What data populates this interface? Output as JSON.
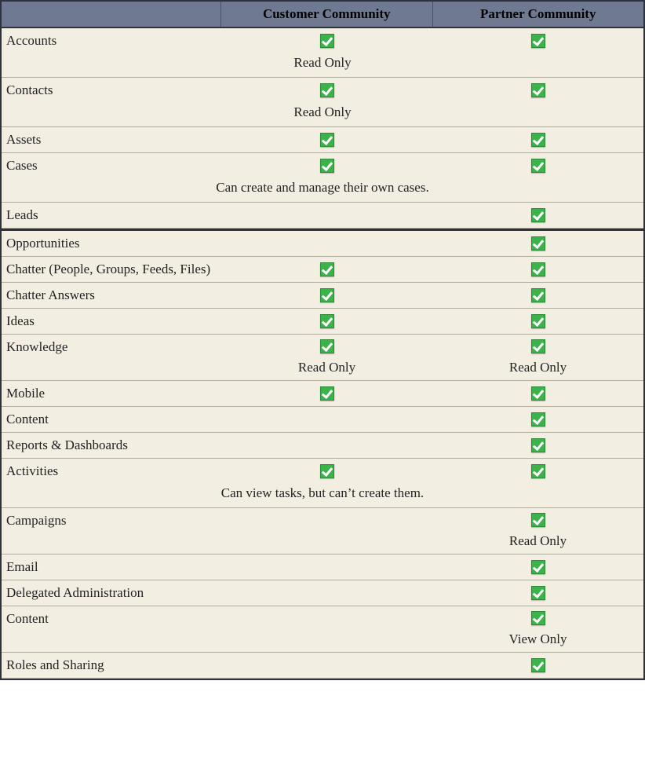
{
  "headers": {
    "feature": "",
    "customer": "Customer Community",
    "partner": "Partner Community"
  },
  "rows": [
    {
      "feature": "Accounts",
      "customer_check": true,
      "partner_check": true,
      "span_note": "Read Only",
      "customer_note": "",
      "partner_note": ""
    },
    {
      "feature": "Contacts",
      "customer_check": true,
      "partner_check": true,
      "span_note": "Read Only",
      "customer_note": "",
      "partner_note": ""
    },
    {
      "feature": "Assets",
      "customer_check": true,
      "partner_check": true,
      "span_note": "",
      "customer_note": "",
      "partner_note": ""
    },
    {
      "feature": "Cases",
      "customer_check": true,
      "partner_check": true,
      "span_note": "Can create and manage their own cases.",
      "customer_note": "",
      "partner_note": ""
    },
    {
      "feature": "Leads",
      "customer_check": false,
      "partner_check": true,
      "span_note": "",
      "customer_note": "",
      "partner_note": "",
      "break_after": true
    },
    {
      "feature": "Opportunities",
      "customer_check": false,
      "partner_check": true,
      "span_note": "",
      "customer_note": "",
      "partner_note": ""
    },
    {
      "feature": "Chatter (People, Groups, Feeds, Files)",
      "customer_check": true,
      "partner_check": true,
      "span_note": "",
      "customer_note": "",
      "partner_note": ""
    },
    {
      "feature": "Chatter Answers",
      "customer_check": true,
      "partner_check": true,
      "span_note": "",
      "customer_note": "",
      "partner_note": ""
    },
    {
      "feature": "Ideas",
      "customer_check": true,
      "partner_check": true,
      "span_note": "",
      "customer_note": "",
      "partner_note": ""
    },
    {
      "feature": "Knowledge",
      "customer_check": true,
      "partner_check": true,
      "span_note": "",
      "customer_note": "Read Only",
      "partner_note": "Read Only"
    },
    {
      "feature": "Mobile",
      "customer_check": true,
      "partner_check": true,
      "span_note": "",
      "customer_note": "",
      "partner_note": ""
    },
    {
      "feature": "Content",
      "customer_check": false,
      "partner_check": true,
      "span_note": "",
      "customer_note": "",
      "partner_note": ""
    },
    {
      "feature": "Reports & Dashboards",
      "customer_check": false,
      "partner_check": true,
      "span_note": "",
      "customer_note": "",
      "partner_note": ""
    },
    {
      "feature": "Activities",
      "customer_check": true,
      "partner_check": true,
      "span_note": "Can view tasks, but can’t create them.",
      "customer_note": "",
      "partner_note": ""
    },
    {
      "feature": "Campaigns",
      "customer_check": false,
      "partner_check": true,
      "span_note": "",
      "customer_note": "",
      "partner_note": "Read Only"
    },
    {
      "feature": "Email",
      "customer_check": false,
      "partner_check": true,
      "span_note": "",
      "customer_note": "",
      "partner_note": ""
    },
    {
      "feature": "Delegated Administration",
      "customer_check": false,
      "partner_check": true,
      "span_note": "",
      "customer_note": "",
      "partner_note": ""
    },
    {
      "feature": "Content",
      "customer_check": false,
      "partner_check": true,
      "span_note": "",
      "customer_note": "",
      "partner_note": "View Only"
    },
    {
      "feature": "Roles and Sharing",
      "customer_check": false,
      "partner_check": true,
      "span_note": "",
      "customer_note": "",
      "partner_note": ""
    }
  ]
}
